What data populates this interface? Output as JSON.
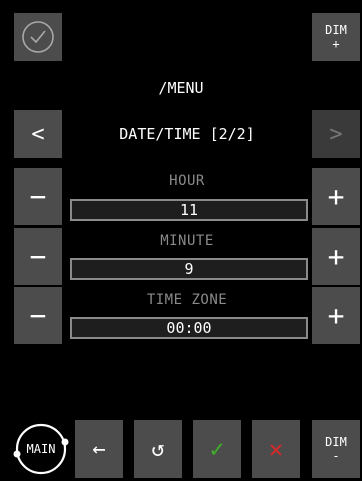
{
  "header": {
    "path": "/MENU",
    "dim_plus": {
      "line1": "DIM",
      "line2": "+"
    }
  },
  "nav": {
    "prev": "<",
    "next": ">",
    "title": "DATE/TIME [2/2]"
  },
  "fields": [
    {
      "label": "HOUR",
      "value": "11",
      "minus": "−",
      "plus": "+"
    },
    {
      "label": "MINUTE",
      "value": "9",
      "minus": "−",
      "plus": "+"
    },
    {
      "label": "TIME ZONE",
      "value": "00:00",
      "minus": "−",
      "plus": "+"
    }
  ],
  "footer": {
    "main_label": "MAIN",
    "back": "←",
    "reset": "↺",
    "confirm": "✓",
    "cancel": "✕",
    "dim_minus": {
      "line1": "DIM",
      "line2": "-"
    }
  },
  "colors": {
    "button": "#4c4c4c",
    "disabled_button": "#3a3a3a",
    "confirm_green": "#3fae2a",
    "cancel_red": "#d42a2a",
    "label_grey": "#8a8a8a"
  }
}
